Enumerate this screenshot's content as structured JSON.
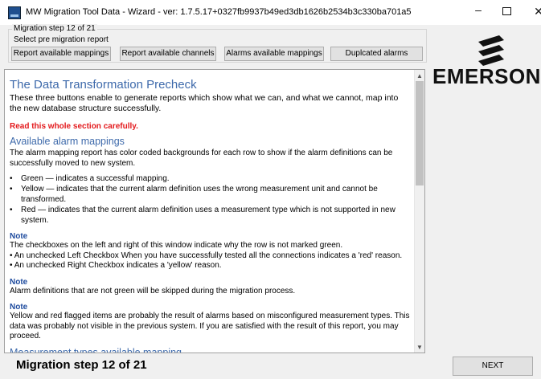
{
  "window": {
    "title": "MW Migration Tool Data - Wizard - ver: 1.7.5.17+0327fb9937b49ed3db1626b2534b3c330ba701a5",
    "minimize_glyph": "–",
    "close_glyph": "✕"
  },
  "step_group": {
    "legend": "Migration step 12 of 21",
    "sub_label": "Select pre migration report"
  },
  "buttons": {
    "report_mappings": "Report available mappings",
    "report_channels": "Report available channels",
    "alarms_mappings": "Alarms available mappings",
    "duplicated_alarms": "Duplcated alarms"
  },
  "logo": {
    "text": "EMERSON"
  },
  "content": {
    "heading": "The Data Transformation Precheck",
    "intro": "These three buttons enable to generate reports which show what we can, and what we cannot, map into the new database structure successfully.",
    "warning": "Read this whole section carefully.",
    "section_heading": "Available alarm mappings",
    "section_text": "The alarm mapping report has color coded backgrounds for each row to show if the alarm definitions can be successfully moved to new system.",
    "bullets": [
      "Green — indicates a successful mapping.",
      "Yellow — indicates that the current alarm definition uses the wrong measurement unit and cannot be transformed.",
      "Red — indicates that the current alarm definition uses a measurement type which is not supported in new system."
    ],
    "note1_label": "Note",
    "note1_text": "The checkboxes on the left and right of this window indicate why the row is not marked green.",
    "note1_lines": [
      "• An unchecked Left Checkbox When you have successfully tested all the connections indicates a 'red' reason.",
      "• An unchecked Right Checkbox indicates a 'yellow' reason."
    ],
    "note2_label": "Note",
    "note2_text": "Alarm definitions that are not green will be skipped during the migration process.",
    "note3_label": "Note",
    "note3_text": "Yellow and red flagged items are probably the result of alarms based on misconfigured measurement types. This data was probably not visible in the previous system. If you are satisfied with the result of this report, you may proceed.",
    "next_heading": "Measurement types available mapping"
  },
  "footer": {
    "step_text": "Migration step 12 of 21",
    "next_label": "NEXT"
  },
  "colors": {
    "heading": "#3e6aab",
    "warning": "#e3191c",
    "note": "#1e4b9e"
  }
}
